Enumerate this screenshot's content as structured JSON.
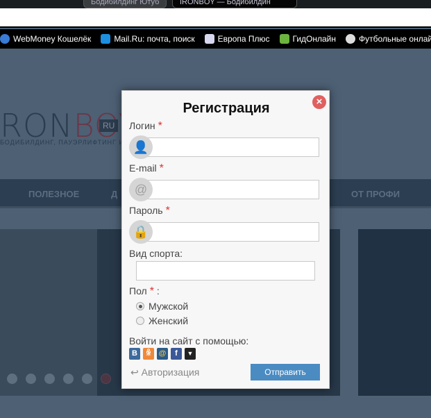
{
  "browser": {
    "tabs": [
      {
        "label": "Бодибилдинг Ютуб",
        "active": false
      },
      {
        "label": "IRONBOY — Бодибилдин",
        "active": true
      }
    ],
    "bookmarks": [
      {
        "label": "WebMoney Кошелёк",
        "icon": "globe-icon",
        "color": "#3a7bd5"
      },
      {
        "label": "Mail.Ru: почта, поиск",
        "icon": "mailru-icon",
        "color": "#1c8fe0"
      },
      {
        "label": "Европа Плюс",
        "icon": "europaplus-icon",
        "color": "#d8d8f0"
      },
      {
        "label": "ГидОнлайн",
        "icon": "gidonline-icon",
        "color": "#6cb33f"
      },
      {
        "label": "Футбольные онлай",
        "icon": "football-icon",
        "color": "#ddd"
      }
    ]
  },
  "site": {
    "logo": {
      "ron": "RON",
      "boy": "BOY",
      "ru": "RU",
      "slogan": "БОДИБИЛДИНГ, ПАУЭРЛИФТИНГ И ФИТНЕС"
    },
    "nav": [
      "ПОЛЕЗНОЕ",
      "Д",
      "ОТ ПРОФИ"
    ],
    "slider_dots": 6,
    "slider_active_dot": 6
  },
  "modal": {
    "title": "Регистрация",
    "close_icon": "close-icon",
    "fields": [
      {
        "label": "Логин",
        "required": true,
        "icon": "user-icon",
        "value": ""
      },
      {
        "label": "E-mail",
        "required": true,
        "icon": "at-icon",
        "value": ""
      },
      {
        "label": "Пароль",
        "required": true,
        "icon": "lock-icon",
        "value": ""
      }
    ],
    "sport_label": "Вид спорта:",
    "sport_value": "",
    "gender_label": "Пол",
    "gender_suffix": ":",
    "genders": [
      {
        "label": "Мужской",
        "checked": true
      },
      {
        "label": "Женский",
        "checked": false
      }
    ],
    "social_label": "Войти на сайт с помощью:",
    "social": [
      {
        "name": "vk",
        "glyph": "B",
        "color": "#3d6a9c"
      },
      {
        "name": "odnoklassniki",
        "glyph": "ꆜ",
        "color": "#f0883a"
      },
      {
        "name": "mailru",
        "glyph": "@",
        "color": "#2a5c8c"
      },
      {
        "name": "facebook",
        "glyph": "f",
        "color": "#3b5998"
      },
      {
        "name": "more",
        "glyph": "▼",
        "color": "#222"
      }
    ],
    "auth_link": "Авторизация",
    "submit": "Отправить",
    "accent": "#4a8bc2"
  }
}
